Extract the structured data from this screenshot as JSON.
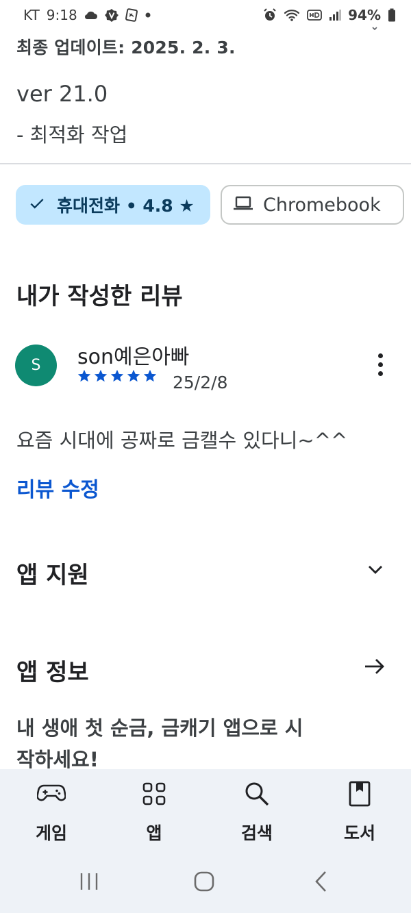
{
  "status_bar": {
    "carrier": "KT",
    "time": "9:18",
    "battery": "94%"
  },
  "whats_new": {
    "last_updated": "최종 업데이트: 2025. 2. 3.",
    "version": "ver 21.0",
    "notes": "- 최적화 작업"
  },
  "device_chips": {
    "phone": {
      "label": "휴대전화 • 4.8 ★",
      "selected": true
    },
    "chromebook": {
      "label": "Chromebook",
      "selected": false
    }
  },
  "my_review": {
    "heading": "내가 작성한 리뷰",
    "avatar_letter": "S",
    "reviewer_name": "son예은아빠",
    "rating": 5,
    "date": "25/2/8",
    "text": "요즘 시대에 공짜로 금캘수 있다니~^^",
    "edit_label": "리뷰 수정"
  },
  "app_support": {
    "heading": "앱 지원"
  },
  "app_info": {
    "heading": "앱 정보",
    "description": "내 생애 첫 순금, 금캐기 앱으로 시작하세요!"
  },
  "bottom_nav": {
    "games": "게임",
    "apps": "앱",
    "search": "검색",
    "books": "도서"
  },
  "colors": {
    "accent_blue": "#0b57d0",
    "chip_selected_bg": "#c2e7ff",
    "avatar_bg": "#0f8a72",
    "nav_bg": "#eef2f7"
  }
}
